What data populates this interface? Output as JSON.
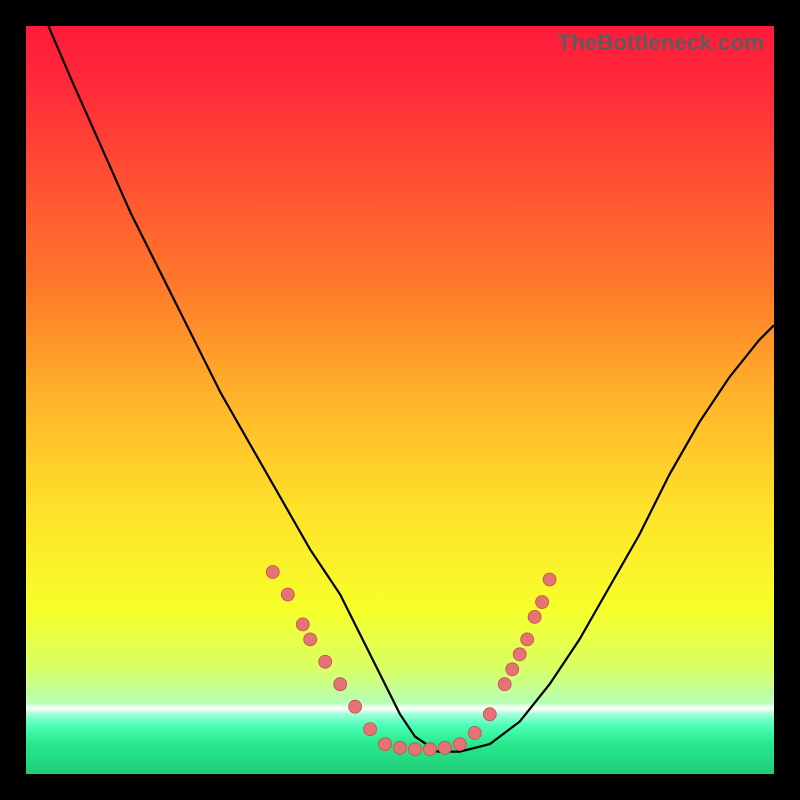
{
  "watermark": "TheBottleneck.com",
  "colors": {
    "black": "#000000",
    "curve": "#000000",
    "dot_fill": "#e57373",
    "dot_stroke": "#c94f4f",
    "gradient_stops": [
      {
        "offset": 0.0,
        "color": "#ff1a3a"
      },
      {
        "offset": 0.08,
        "color": "#ff2a3a"
      },
      {
        "offset": 0.2,
        "color": "#ff4e33"
      },
      {
        "offset": 0.35,
        "color": "#ff7a2a"
      },
      {
        "offset": 0.5,
        "color": "#ffb52a"
      },
      {
        "offset": 0.65,
        "color": "#ffe22a"
      },
      {
        "offset": 0.78,
        "color": "#f6ff2a"
      },
      {
        "offset": 0.86,
        "color": "#d8ff66"
      },
      {
        "offset": 0.905,
        "color": "#b7ffb7"
      },
      {
        "offset": 0.912,
        "color": "#ffffff"
      },
      {
        "offset": 0.92,
        "color": "#9fffd8"
      },
      {
        "offset": 0.935,
        "color": "#4bffb7"
      },
      {
        "offset": 0.96,
        "color": "#27e88b"
      },
      {
        "offset": 1.0,
        "color": "#20cc78"
      }
    ]
  },
  "chart_data": {
    "type": "line",
    "title": "",
    "xlabel": "",
    "ylabel": "",
    "xlim": [
      0,
      100
    ],
    "ylim": [
      0,
      100
    ],
    "grid": false,
    "legend": false,
    "series": [
      {
        "name": "bottleneck-curve",
        "x": [
          3,
          6,
          10,
          14,
          18,
          22,
          26,
          30,
          34,
          38,
          42,
          45,
          48,
          50,
          52,
          55,
          58,
          62,
          66,
          70,
          74,
          78,
          82,
          86,
          90,
          94,
          98,
          100
        ],
        "y": [
          100,
          93,
          84,
          75,
          67,
          59,
          51,
          44,
          37,
          30,
          24,
          18,
          12,
          8,
          5,
          3,
          3,
          4,
          7,
          12,
          18,
          25,
          32,
          40,
          47,
          53,
          58,
          60
        ]
      }
    ],
    "scatter": [
      {
        "name": "curve-markers",
        "points": [
          {
            "x": 33,
            "y": 27
          },
          {
            "x": 35,
            "y": 24
          },
          {
            "x": 37,
            "y": 20
          },
          {
            "x": 38,
            "y": 18
          },
          {
            "x": 40,
            "y": 15
          },
          {
            "x": 42,
            "y": 12
          },
          {
            "x": 44,
            "y": 9
          },
          {
            "x": 46,
            "y": 6
          },
          {
            "x": 48,
            "y": 4
          },
          {
            "x": 50,
            "y": 3.5
          },
          {
            "x": 52,
            "y": 3.3
          },
          {
            "x": 54,
            "y": 3.3
          },
          {
            "x": 56,
            "y": 3.5
          },
          {
            "x": 58,
            "y": 4
          },
          {
            "x": 60,
            "y": 5.5
          },
          {
            "x": 62,
            "y": 8
          },
          {
            "x": 64,
            "y": 12
          },
          {
            "x": 65,
            "y": 14
          },
          {
            "x": 66,
            "y": 16
          },
          {
            "x": 67,
            "y": 18
          },
          {
            "x": 68,
            "y": 21
          },
          {
            "x": 69,
            "y": 23
          },
          {
            "x": 70,
            "y": 26
          }
        ]
      }
    ]
  }
}
